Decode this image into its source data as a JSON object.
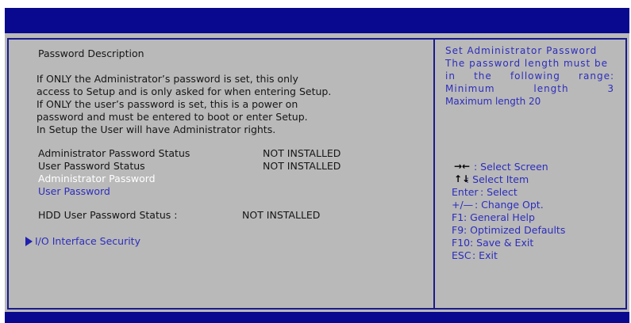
{
  "left": {
    "password_description_title": "Password Description",
    "desc_lines": [
      "If ONLY the Administrator’s password is set, this only",
      "access to Setup and is only asked for when entering Setup.",
      "If ONLY the user’s password is set, this is a power on",
      "password and must be entered to boot or enter Setup.",
      "In Setup the User will have Administrator rights."
    ],
    "admin_status_label": "Administrator Password Status",
    "admin_status_value": "NOT INSTALLED",
    "user_status_label": "User Password Status",
    "user_status_value": "NOT INSTALLED",
    "admin_password_item": "Administrator Password",
    "user_password_item": "User Password",
    "hdd_status_label": "HDD User Password Status  :",
    "hdd_status_value": "NOT INSTALLED",
    "io_security_item": "I/O Interface Security"
  },
  "right": {
    "help_lines": [
      "Set Administrator Password",
      "The password length must be",
      "in the following range:",
      "Minimum length 3",
      "Maximum length 20"
    ],
    "keys": [
      {
        "key": "→←",
        "desc": ": Select Screen"
      },
      {
        "key": "↑↓",
        "desc": ":    Select Item"
      },
      {
        "key": "Enter",
        "desc": ": Select"
      },
      {
        "key": "+/—",
        "desc": ": Change Opt."
      },
      {
        "key": "F1",
        "desc": ":    General Help"
      },
      {
        "key": "F9",
        "desc": ":    Optimized Defaults"
      },
      {
        "key": "F10",
        "desc": ":  Save & Exit"
      },
      {
        "key": "ESC",
        "desc": ":  Exit"
      }
    ]
  },
  "colors": {
    "frame_blue": "#09098f",
    "panel_gray": "#b9b9b9",
    "link_blue": "#2d2dbe",
    "selected_text": "#ffffff"
  }
}
